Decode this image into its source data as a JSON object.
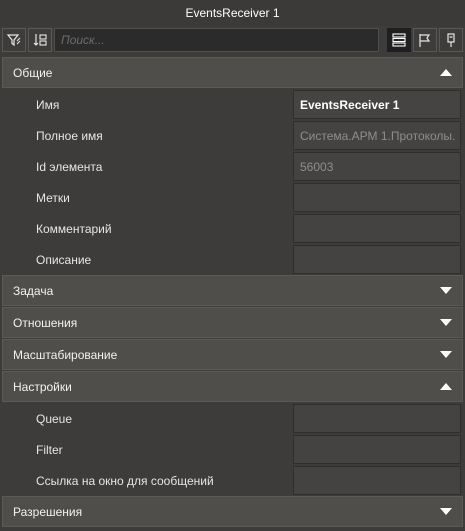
{
  "window": {
    "title": "EventsReceiver 1"
  },
  "toolbar": {
    "search_placeholder": "Поиск...",
    "icons": [
      "filter-icon",
      "sort-icon",
      "list-view-icon",
      "flag-icon",
      "pin-icon"
    ]
  },
  "sections": {
    "general": {
      "label": "Общие",
      "expanded": true,
      "rows": [
        {
          "label": "Имя",
          "value": "EventsReceiver 1"
        },
        {
          "label": "Полное имя",
          "value": "Система.АРМ 1.Протоколы."
        },
        {
          "label": "Id элемента",
          "value": "56003"
        },
        {
          "label": "Метки",
          "value": ""
        },
        {
          "label": "Комментарий",
          "value": ""
        },
        {
          "label": "Описание",
          "value": ""
        }
      ]
    },
    "task": {
      "label": "Задача",
      "expanded": false
    },
    "relations": {
      "label": "Отношения",
      "expanded": false
    },
    "scaling": {
      "label": "Масштабирование",
      "expanded": false
    },
    "settings": {
      "label": "Настройки",
      "expanded": true,
      "rows": [
        {
          "label": "Queue",
          "value": ""
        },
        {
          "label": "Filter",
          "value": ""
        },
        {
          "label": "Ссылка на окно для сообщений",
          "value": ""
        }
      ]
    },
    "permissions": {
      "label": "Разрешения",
      "expanded": false
    }
  }
}
